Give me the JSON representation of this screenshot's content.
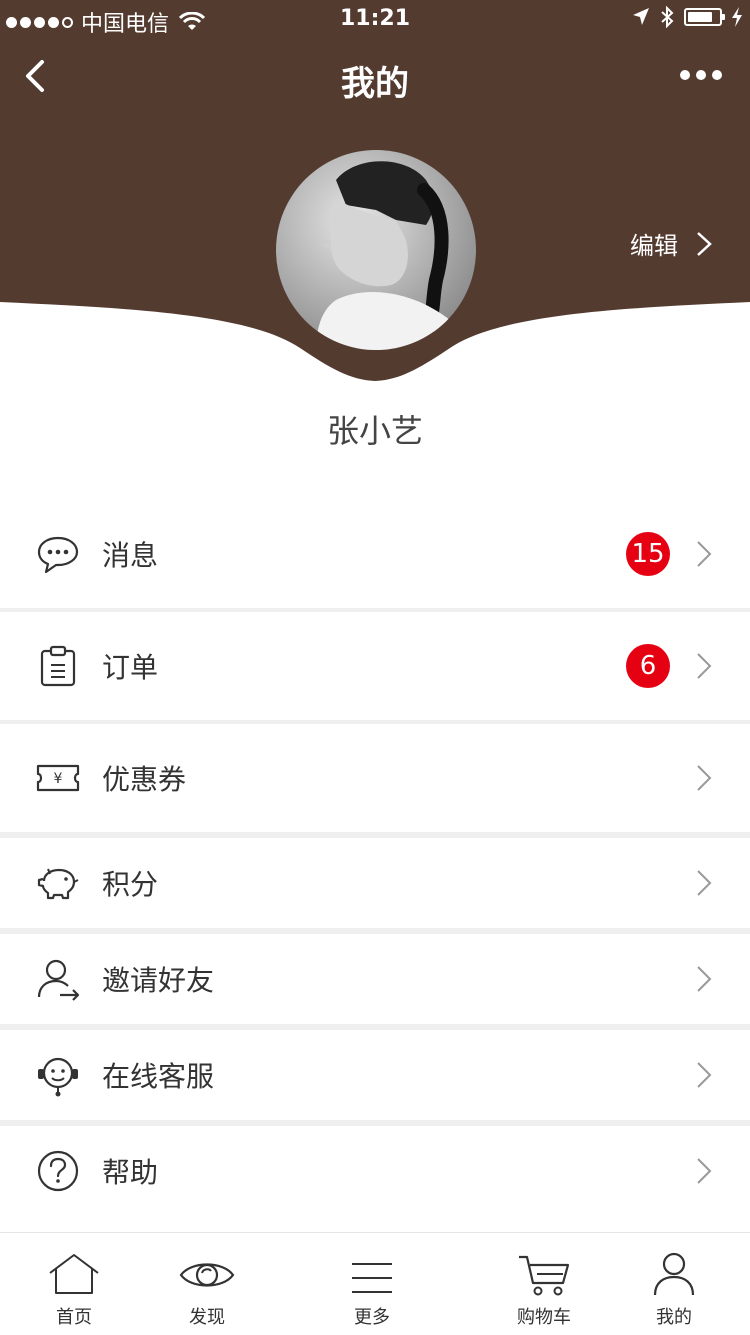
{
  "status_bar": {
    "carrier": "中国电信",
    "time": "11:21"
  },
  "nav": {
    "title": "我的"
  },
  "profile": {
    "edit_label": "编辑",
    "name": "张小艺"
  },
  "menu": [
    {
      "label": "消息",
      "icon": "chat-bubble-icon",
      "badge": "15"
    },
    {
      "label": "订单",
      "icon": "clipboard-icon",
      "badge": "6"
    },
    {
      "label": "优惠券",
      "icon": "coupon-icon",
      "badge": ""
    },
    {
      "label": "积分",
      "icon": "piggy-bank-icon",
      "badge": ""
    },
    {
      "label": "邀请好友",
      "icon": "invite-user-icon",
      "badge": ""
    },
    {
      "label": "在线客服",
      "icon": "headset-icon",
      "badge": ""
    },
    {
      "label": "帮助",
      "icon": "help-icon",
      "badge": ""
    }
  ],
  "tabbar": [
    {
      "label": "首页",
      "icon": "home-icon"
    },
    {
      "label": "发现",
      "icon": "eye-icon"
    },
    {
      "label": "更多",
      "icon": "menu-icon"
    },
    {
      "label": "购物车",
      "icon": "cart-icon"
    },
    {
      "label": "我的",
      "icon": "user-icon"
    }
  ],
  "colors": {
    "header_brown": "#543b30",
    "badge_red": "#e50012",
    "separator": "#efefef"
  }
}
